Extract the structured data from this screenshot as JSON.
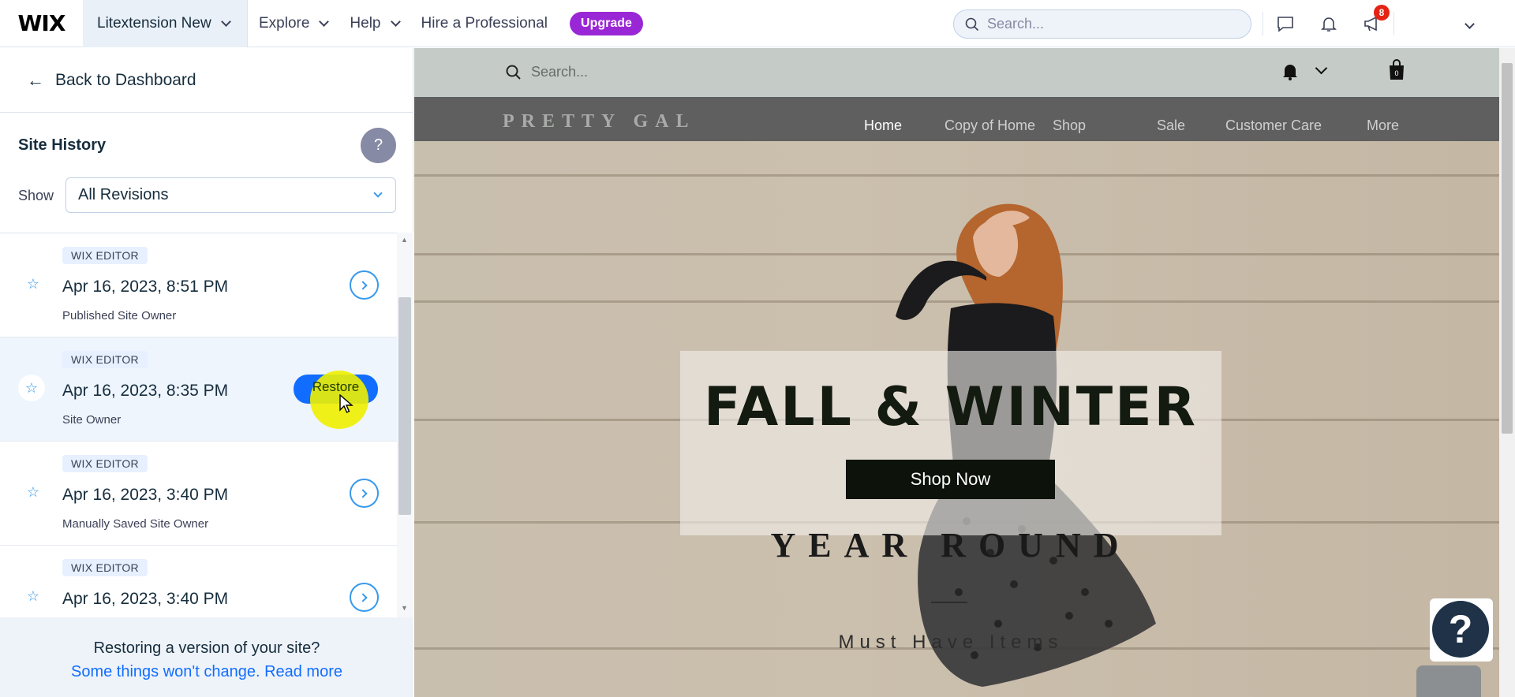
{
  "topbar": {
    "logo": "WIX",
    "site_name": "Litextension New",
    "nav": [
      "Explore",
      "Help",
      "Hire a Professional"
    ],
    "upgrade": "Upgrade",
    "search_placeholder": "Search...",
    "notifications_badge": "8"
  },
  "panel": {
    "back": "Back to Dashboard",
    "title": "Site History",
    "help": "?",
    "show_label": "Show",
    "filter_value": "All Revisions",
    "revisions": [
      {
        "tag": "WIX EDITOR",
        "date": "Apr 16, 2023, 8:51 PM",
        "sub": "Published Site Owner"
      },
      {
        "tag": "WIX EDITOR",
        "date": "Apr 16, 2023, 8:35 PM",
        "sub": "Site Owner",
        "action": "Restore"
      },
      {
        "tag": "WIX EDITOR",
        "date": "Apr 16, 2023, 3:40 PM",
        "sub": "Manually Saved Site Owner"
      },
      {
        "tag": "WIX EDITOR",
        "date": "Apr 16, 2023, 3:40 PM",
        "sub": ""
      }
    ],
    "footer_line1": "Restoring a version of your site?",
    "footer_line2": "Some things won't change. Read more"
  },
  "preview": {
    "search_placeholder": "Search...",
    "cart_count": "0",
    "brand": "PRETTY GAL",
    "nav": [
      "Home",
      "Copy of Home",
      "Shop",
      "Sale",
      "Customer Care",
      "More"
    ],
    "hero_title": "FALL & WINTER",
    "cta": "Shop Now",
    "subtitle": "YEAR ROUND",
    "tagline": "Must Have Items"
  },
  "colors": {
    "accent": "#116dff",
    "upgrade": "#9a27d5",
    "badge": "#e62214"
  }
}
